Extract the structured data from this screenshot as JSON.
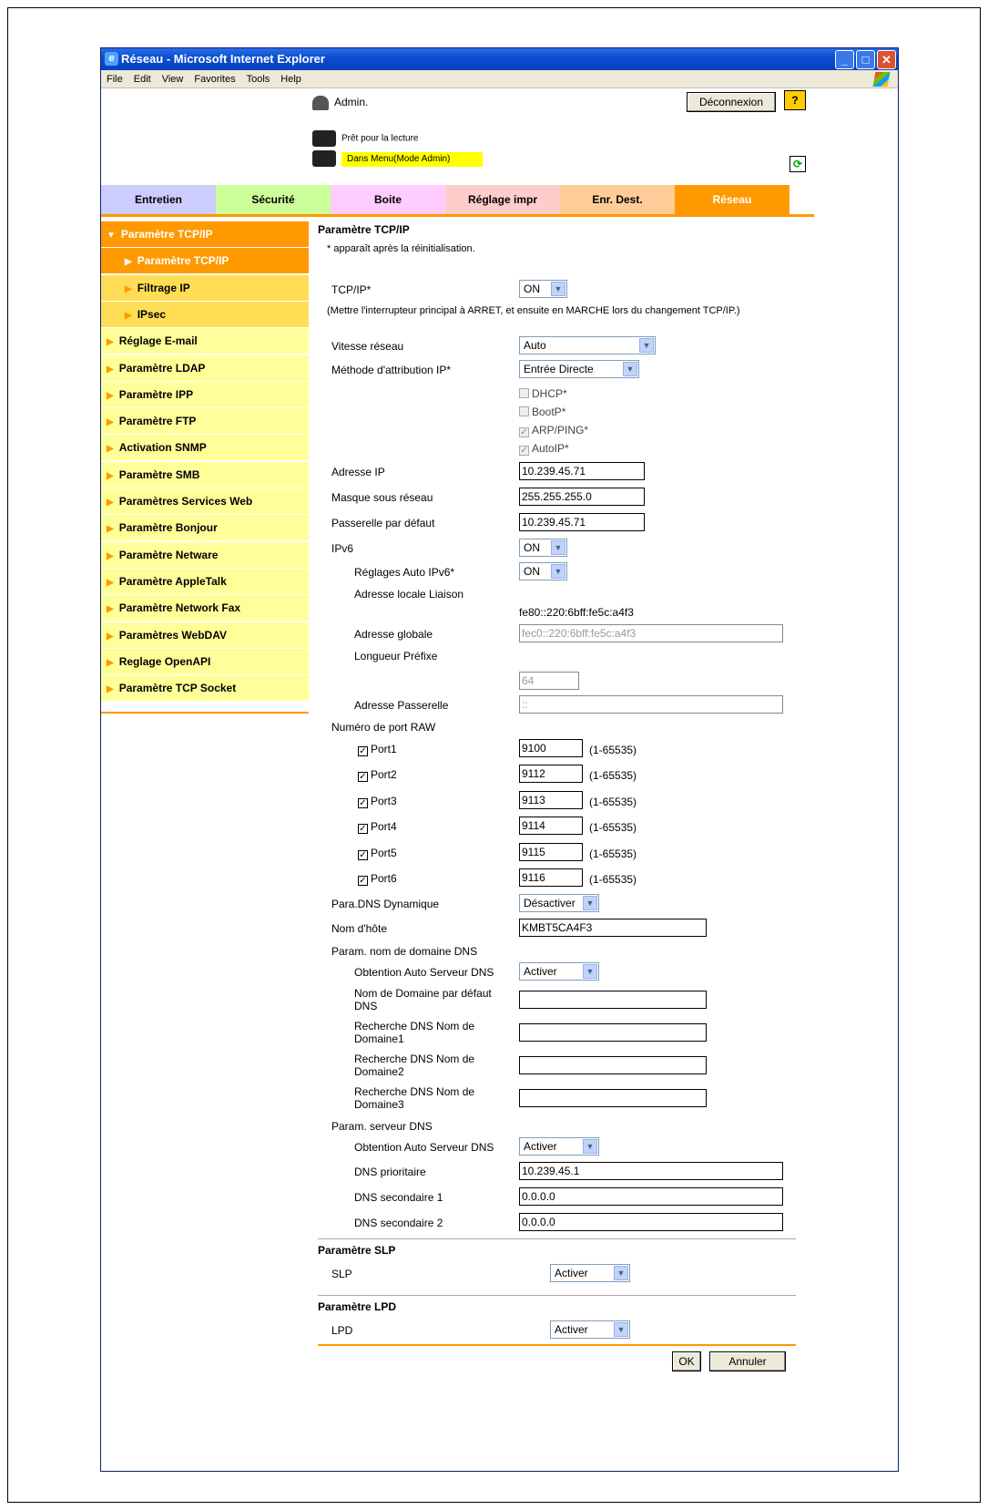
{
  "window": {
    "title": "Réseau - Microsoft Internet Explorer",
    "menu": [
      "File",
      "Edit",
      "View",
      "Favorites",
      "Tools",
      "Help"
    ]
  },
  "header": {
    "user": "Admin.",
    "logout": "Déconnexion",
    "help": "?",
    "status1": "Prêt pour la lecture",
    "status2": "Dans Menu(Mode Admin)"
  },
  "tabs": [
    {
      "label": "Entretien",
      "color": "#ccccff"
    },
    {
      "label": "Sécurité",
      "color": "#ccff99"
    },
    {
      "label": "Boite",
      "color": "#ffccff"
    },
    {
      "label": "Réglage impr",
      "color": "#ffcccc"
    },
    {
      "label": "Enr. Dest.",
      "color": "#ffcc99"
    },
    {
      "label": "Réseau",
      "color": "#ff9900"
    }
  ],
  "sidebar": [
    {
      "label": "Paramètre TCP/IP",
      "state": "open"
    },
    {
      "label": "Paramètre TCP/IP",
      "state": "sub-active"
    },
    {
      "label": "Filtrage IP",
      "state": "sub"
    },
    {
      "label": "IPsec",
      "state": "sub"
    },
    {
      "label": "Réglage E-mail",
      "state": "item"
    },
    {
      "label": "Paramètre LDAP",
      "state": "item"
    },
    {
      "label": "Paramètre IPP",
      "state": "item"
    },
    {
      "label": "Paramètre FTP",
      "state": "item"
    },
    {
      "label": "Activation SNMP",
      "state": "item"
    },
    {
      "label": "Paramètre SMB",
      "state": "item"
    },
    {
      "label": "Paramètres Services Web",
      "state": "item"
    },
    {
      "label": "Paramètre Bonjour",
      "state": "item"
    },
    {
      "label": "Paramètre Netware",
      "state": "item"
    },
    {
      "label": "Paramètre AppleTalk",
      "state": "item"
    },
    {
      "label": "Paramètre Network Fax",
      "state": "item"
    },
    {
      "label": "Paramètres WebDAV",
      "state": "item"
    },
    {
      "label": "Reglage OpenAPI",
      "state": "item"
    },
    {
      "label": "Paramètre TCP Socket",
      "state": "item"
    }
  ],
  "form": {
    "title": "Paramètre TCP/IP",
    "note": "* apparaît après la réinitialisation.",
    "tcpip_label": "TCP/IP*",
    "tcpip_value": "ON",
    "tcpip_note": "(Mettre l'interrupteur principal à ARRET, et ensuite en MARCHE lors du changement TCP/IP.)",
    "speed_label": "Vitesse réseau",
    "speed_value": "Auto",
    "method_label": "Méthode d'attribution IP*",
    "method_value": "Entrée Directe",
    "dhcp": "DHCP*",
    "bootp": "BootP*",
    "arp": "ARP/PING*",
    "autoip": "AutoIP*",
    "ip_label": "Adresse IP",
    "ip_value": "10.239.45.71",
    "mask_label": "Masque sous réseau",
    "mask_value": "255.255.255.0",
    "gw_label": "Passerelle par défaut",
    "gw_value": "10.239.45.71",
    "ipv6_label": "IPv6",
    "ipv6_value": "ON",
    "ipv6auto_label": "Réglages Auto IPv6*",
    "ipv6auto_value": "ON",
    "link_label": "Adresse locale Liaison",
    "link_value": "fe80::220:6bff:fe5c:a4f3",
    "global_label": "Adresse globale",
    "global_value": "fec0::220:6bff:fe5c:a4f3",
    "prefix_label": "Longueur Préfixe",
    "prefix_value": "64",
    "gwaddr_label": "Adresse Passerelle",
    "gwaddr_value": "::",
    "raw_label": "Numéro de port RAW",
    "ports": [
      {
        "label": "Port1",
        "value": "9100",
        "range": "(1-65535)"
      },
      {
        "label": "Port2",
        "value": "9112",
        "range": "(1-65535)"
      },
      {
        "label": "Port3",
        "value": "9113",
        "range": "(1-65535)"
      },
      {
        "label": "Port4",
        "value": "9114",
        "range": "(1-65535)"
      },
      {
        "label": "Port5",
        "value": "9115",
        "range": "(1-65535)"
      },
      {
        "label": "Port6",
        "value": "9116",
        "range": "(1-65535)"
      }
    ],
    "ddns_label": "Para.DNS Dynamique",
    "ddns_value": "Désactiver",
    "host_label": "Nom d'hôte",
    "host_value": "KMBT5CA4F3",
    "domain_hdr": "Param. nom de domaine DNS",
    "auto1_label": "Obtention Auto Serveur DNS",
    "auto1_value": "Activer",
    "default_domain_label": "Nom de Domaine par défaut DNS",
    "search1_label": "Recherche DNS Nom de Domaine1",
    "search2_label": "Recherche DNS Nom de Domaine2",
    "search3_label": "Recherche DNS Nom de Domaine3",
    "server_hdr": "Param. serveur DNS",
    "auto2_label": "Obtention Auto Serveur DNS",
    "auto2_value": "Activer",
    "dns1_label": "DNS prioritaire",
    "dns1_value": "10.239.45.1",
    "dns2_label": "DNS secondaire 1",
    "dns2_value": "0.0.0.0",
    "dns3_label": "DNS secondaire 2",
    "dns3_value": "0.0.0.0",
    "slp_title": "Paramètre SLP",
    "slp_label": "SLP",
    "slp_value": "Activer",
    "lpd_title": "Paramètre LPD",
    "lpd_label": "LPD",
    "lpd_value": "Activer",
    "ok": "OK",
    "cancel": "Annuler"
  },
  "colors": {
    "accent": "#ff9900",
    "sidebar_bg": "#ffff99",
    "sidebar_sub": "#ffdd55"
  }
}
